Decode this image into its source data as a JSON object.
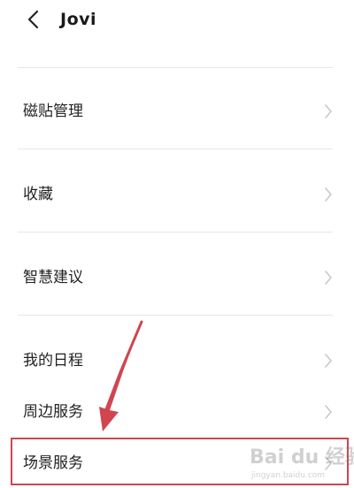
{
  "header": {
    "back_icon": "chevron-left-icon",
    "title": "Jovi"
  },
  "menu": {
    "items": [
      {
        "label": "磁贴管理",
        "icon": "chevron-right-icon"
      },
      {
        "label": "收藏",
        "icon": "chevron-right-icon"
      },
      {
        "label": "智慧建议",
        "icon": "chevron-right-icon"
      },
      {
        "label": "我的日程",
        "icon": "chevron-right-icon"
      },
      {
        "label": "周边服务",
        "icon": "chevron-right-icon"
      },
      {
        "label": "场景服务",
        "icon": "chevron-right-icon"
      }
    ]
  },
  "annotation": {
    "highlight_color": "#d0454f",
    "arrow_color": "#d0454f"
  },
  "watermark": {
    "text": "Bai du 经验",
    "subtext": "jingyan.baidu.com"
  }
}
